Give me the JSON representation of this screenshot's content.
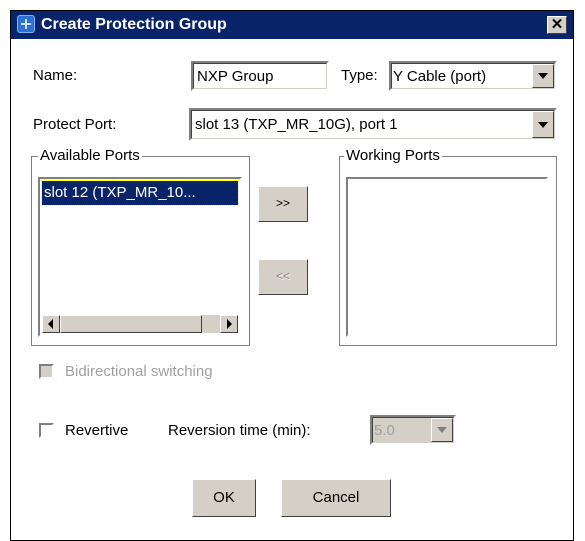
{
  "dialog": {
    "title": "Create Protection Group",
    "close_label": "✕"
  },
  "form": {
    "name_label": "Name:",
    "name_value": "NXP Group",
    "type_label": "Type:",
    "type_value": "Y Cable (port)",
    "protect_port_label": "Protect Port:",
    "protect_port_value": "slot 13 (TXP_MR_10G), port 1"
  },
  "available_ports": {
    "legend": "Available Ports",
    "items": [
      "slot 12 (TXP_MR_10..."
    ]
  },
  "working_ports": {
    "legend": "Working Ports",
    "items": []
  },
  "transfer": {
    "add_label": ">>",
    "remove_label": "<<"
  },
  "options": {
    "bidirectional_label": "Bidirectional switching",
    "bidirectional_checked": false,
    "bidirectional_enabled": false,
    "revertive_label": "Revertive",
    "revertive_checked": false,
    "reversion_time_label": "Reversion time (min):",
    "reversion_time_value": "5.0"
  },
  "actions": {
    "ok_label": "OK",
    "cancel_label": "Cancel"
  },
  "colors": {
    "titlebar": "#0a246a",
    "selection": "#0a246a",
    "face": "#d4d0c8"
  }
}
